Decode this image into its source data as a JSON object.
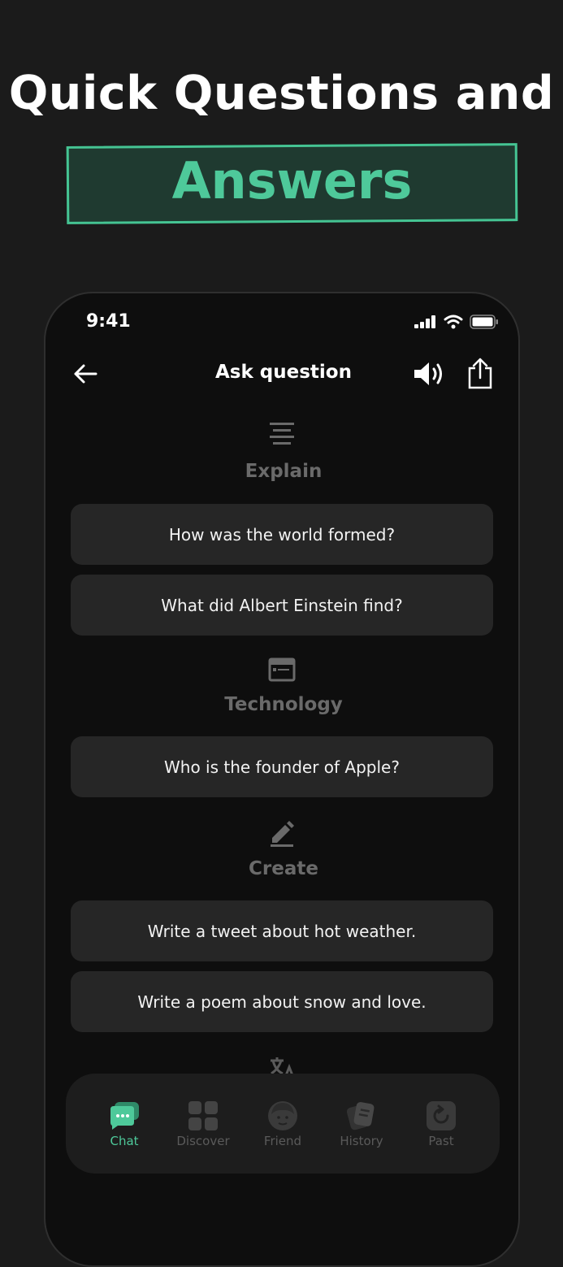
{
  "hero": {
    "line1": "Quick Questions and",
    "line2": "Answers",
    "accent_color": "#4ec99a"
  },
  "status_bar": {
    "time": "9:41"
  },
  "nav": {
    "title": "Ask question"
  },
  "sections": [
    {
      "title": "Explain",
      "icon": "lines-icon",
      "questions": [
        "How was the world formed?",
        "What did Albert Einstein find?"
      ]
    },
    {
      "title": "Technology",
      "icon": "browser-window-icon",
      "questions": [
        "Who is the founder of Apple?"
      ]
    },
    {
      "title": "Create",
      "icon": "pencil-icon",
      "questions": [
        "Write a tweet about hot weather.",
        "Write a poem about snow and love."
      ]
    }
  ],
  "tabs": [
    {
      "label": "Chat",
      "icon": "chat-bubble-icon",
      "active": true
    },
    {
      "label": "Discover",
      "icon": "grid-icon",
      "active": false
    },
    {
      "label": "Friend",
      "icon": "avatar-face-icon",
      "active": false
    },
    {
      "label": "History",
      "icon": "cards-icon",
      "active": false
    },
    {
      "label": "Past",
      "icon": "refresh-icon",
      "active": false
    }
  ]
}
